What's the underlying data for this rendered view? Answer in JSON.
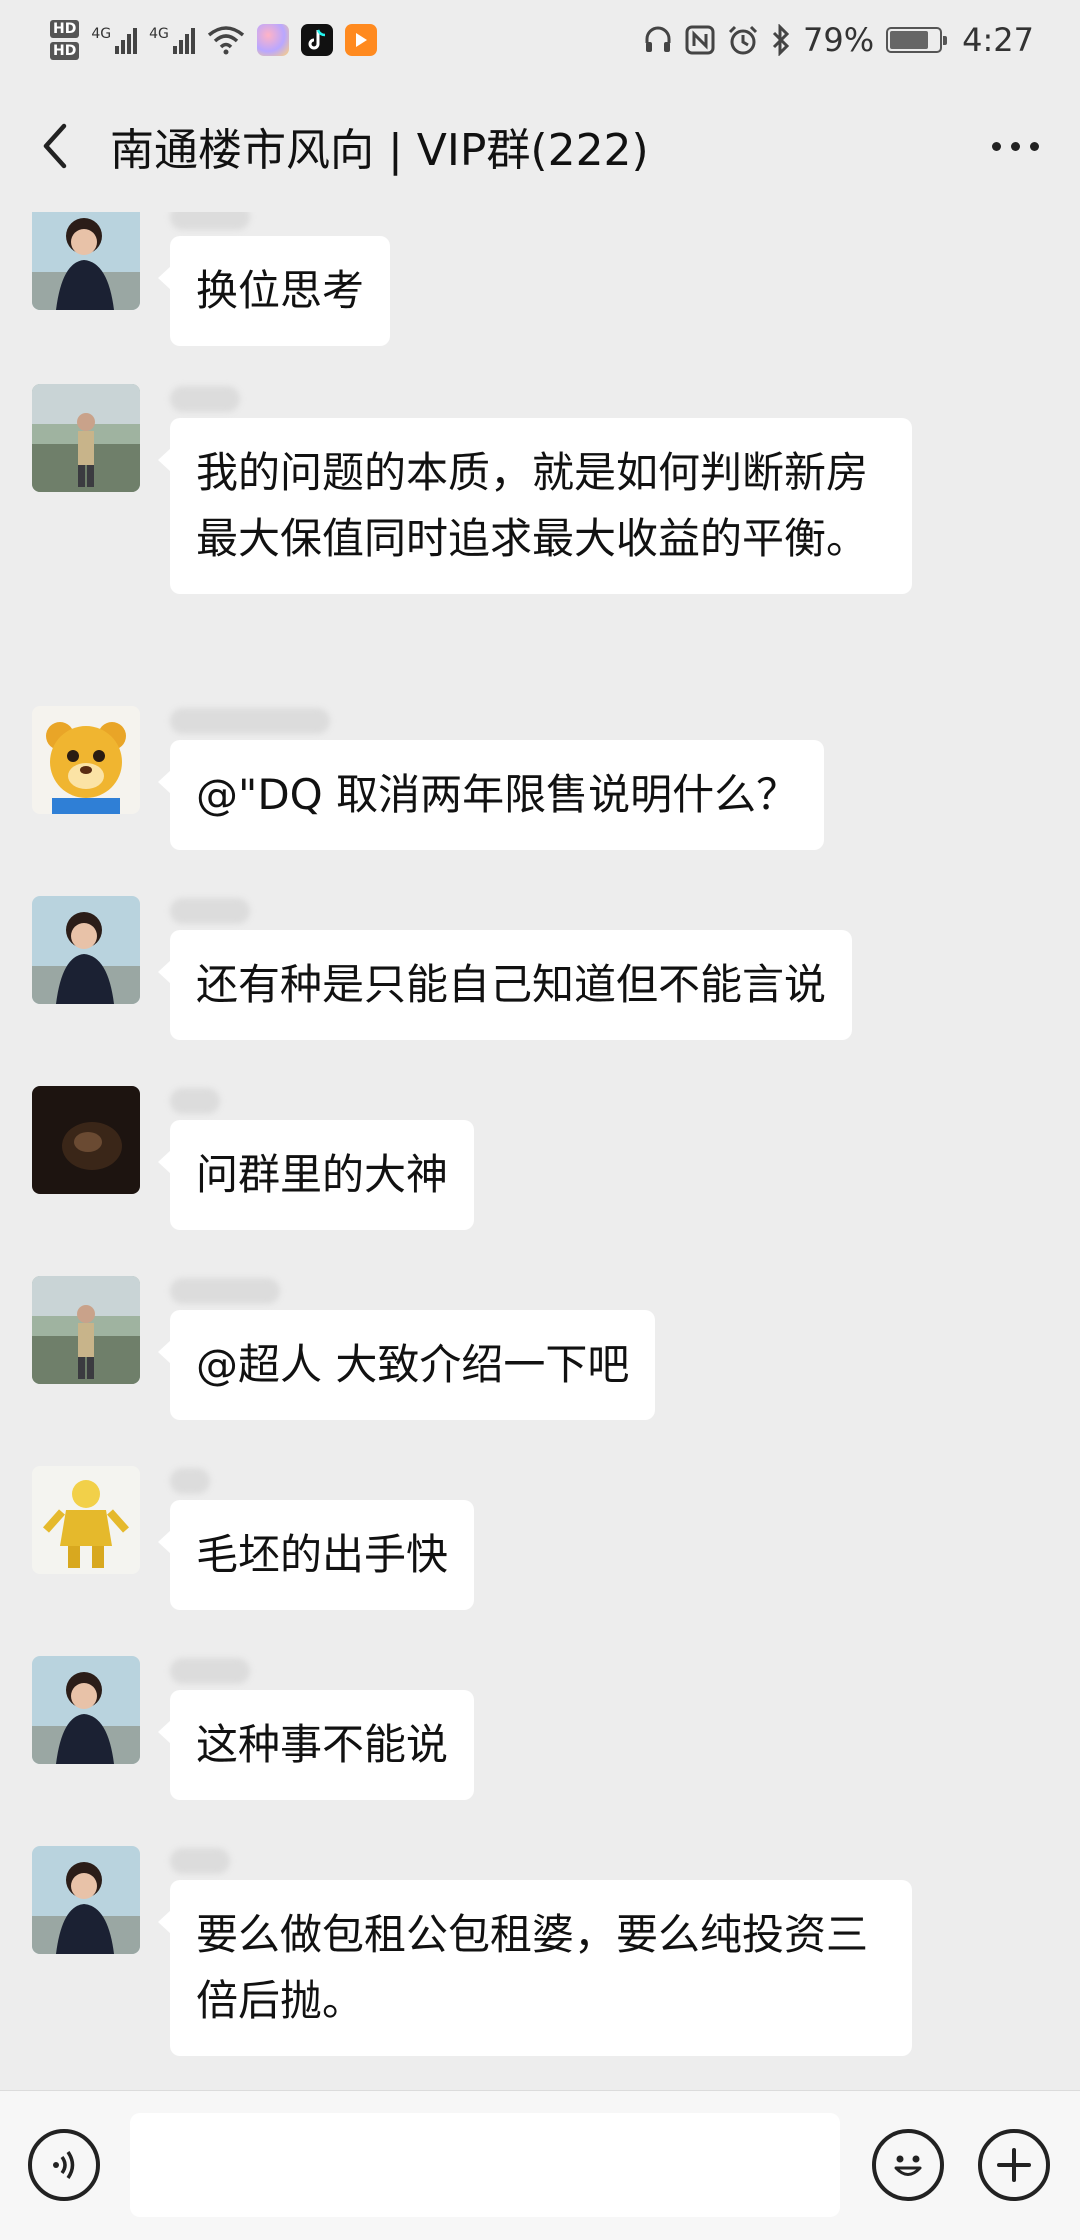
{
  "status_bar": {
    "hd1": "HD",
    "hd2": "HD",
    "net1": "4G",
    "net2": "4G",
    "battery_percent": "79%",
    "battery_level": 0.79,
    "time": "4:27",
    "icons": [
      "signal-icon",
      "wifi-icon",
      "headset-icon",
      "nfc-icon",
      "alarm-icon",
      "bluetooth-icon",
      "battery-icon"
    ]
  },
  "header": {
    "title": "南通楼市风向 | VIP群(222)",
    "back_icon": "chevron-left-icon",
    "more_icon": "more-dots-icon"
  },
  "messages": [
    {
      "avatar": "girl-avatar",
      "text": "换位思考"
    },
    {
      "avatar": "man-outdoor-avatar",
      "text": "我的问题的本质，就是如何判断新房最大保值同时追求最大收益的平衡。"
    },
    {
      "avatar": "bear-avatar",
      "text": "@\"DQ  取消两年限售说明什么？"
    },
    {
      "avatar": "girl-avatar",
      "text": "还有种是只能自己知道但不能言说"
    },
    {
      "avatar": "dark-photo-avatar",
      "text": "问群里的大神"
    },
    {
      "avatar": "man-outdoor-avatar",
      "text": "@超人  大致介绍一下吧"
    },
    {
      "avatar": "gold-figure-avatar",
      "text": "毛坯的出手快"
    },
    {
      "avatar": "girl-avatar",
      "text": "这种事不能说"
    },
    {
      "avatar": "girl-avatar",
      "text": "要么做包租公包租婆，要么纯投资三倍后抛。"
    }
  ],
  "input_bar": {
    "placeholder": "",
    "voice_icon": "voice-icon",
    "emoji_icon": "emoji-icon",
    "plus_icon": "plus-icon"
  }
}
